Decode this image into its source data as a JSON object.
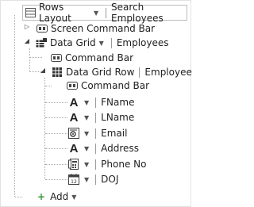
{
  "header": {
    "layout_label": "Rows Layout",
    "search_label": "Search Employees"
  },
  "tree": {
    "screen_command_bar": "Screen Command Bar",
    "data_grid": {
      "label": "Data Grid",
      "entity": "Employees",
      "command_bar": "Command Bar",
      "row": {
        "label": "Data Grid Row",
        "entity": "Employee",
        "command_bar": "Command Bar",
        "fields": [
          {
            "label": "FName",
            "icon": "text-field-icon"
          },
          {
            "label": "LName",
            "icon": "text-field-icon"
          },
          {
            "label": "Email",
            "icon": "email-field-icon"
          },
          {
            "label": "Address",
            "icon": "text-field-icon"
          },
          {
            "label": "Phone No",
            "icon": "phone-field-icon"
          },
          {
            "label": "DOJ",
            "icon": "date-field-icon"
          }
        ]
      }
    },
    "add_label": "Add"
  },
  "colors": {
    "add_plus": "#3a9a3a",
    "tree_lines": "#a8a8a8"
  }
}
